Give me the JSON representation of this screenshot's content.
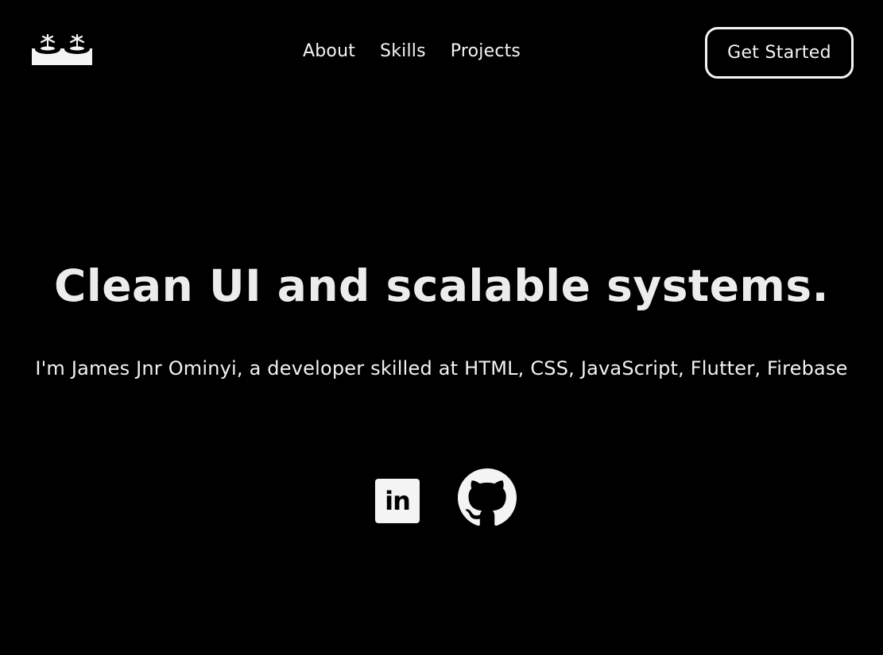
{
  "header": {
    "logo_icon": "palm-islands-logo-icon",
    "nav": [
      {
        "label": "About"
      },
      {
        "label": "Skills"
      },
      {
        "label": "Projects"
      }
    ],
    "cta_label": "Get Started"
  },
  "hero": {
    "title": "Clean UI and scalable systems.",
    "subtitle": "I'm James Jnr Ominyi, a developer skilled at HTML, CSS, JavaScript, Flutter, Firebase"
  },
  "socials": {
    "linkedin": {
      "icon": "linkedin-icon",
      "text": "in"
    },
    "github": {
      "icon": "github-icon"
    }
  },
  "colors": {
    "background": "#000000",
    "foreground": "#f4f4f4"
  }
}
